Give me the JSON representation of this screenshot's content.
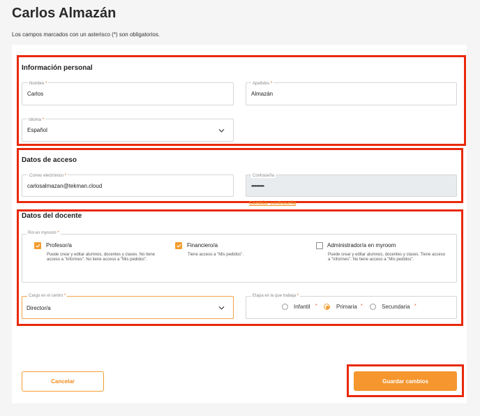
{
  "page": {
    "title": "Carlos Almazán",
    "intro": "Los campos marcados con un asterisco (*) son obligatorios."
  },
  "personal": {
    "title": "Información personal",
    "nombre": {
      "label": "Nombre",
      "value": "Carlos"
    },
    "apellidos": {
      "label": "Apellidos",
      "value": "Almazán"
    },
    "idioma": {
      "label": "Idioma",
      "value": "Español"
    }
  },
  "access": {
    "title": "Datos de acceso",
    "email": {
      "label": "Correo electrónico",
      "value": "carlosalmazan@tekman.cloud"
    },
    "password": {
      "label": "Contraseña",
      "value": "••••••••••"
    },
    "change_password": "Cambiar contraseña"
  },
  "teacher": {
    "title": "Datos del docente",
    "roles_label": "Rol en myroom",
    "roles": [
      {
        "label": "Profesor/a",
        "checked": true,
        "desc": "Puede crear y editar alumnos, docentes y clases. No tiene acceso a \"informes\". No tiene acceso a \"Mis pedidos\"."
      },
      {
        "label": "Financiero/a",
        "checked": true,
        "desc": "Tiene acceso a \"Mis pedidos\"."
      },
      {
        "label": "Administrador/a en myroom",
        "checked": false,
        "desc": "Puede crear y editar alumnos, docentes y clases. Tiene acceso a \"informes\". No tiene acceso a \"Mis pedidos\"."
      }
    ],
    "cargo": {
      "label": "Cargo en el centro",
      "value": "Director/a"
    },
    "etapa": {
      "label": "Etapa en la que trabaja",
      "options": [
        {
          "label": "Infantil",
          "selected": false
        },
        {
          "label": "Primaria",
          "selected": true
        },
        {
          "label": "Secundaria",
          "selected": false
        }
      ]
    }
  },
  "required_mark": "*",
  "actions": {
    "cancel": "Cancelar",
    "save": "Guardar cambios"
  },
  "colors": {
    "accent": "#f39c2e",
    "highlight_frame": "#e8290b",
    "link": "#f08a1c"
  },
  "icons": {
    "select": "chevron-down-icon",
    "checkbox_checked": "check-icon"
  }
}
